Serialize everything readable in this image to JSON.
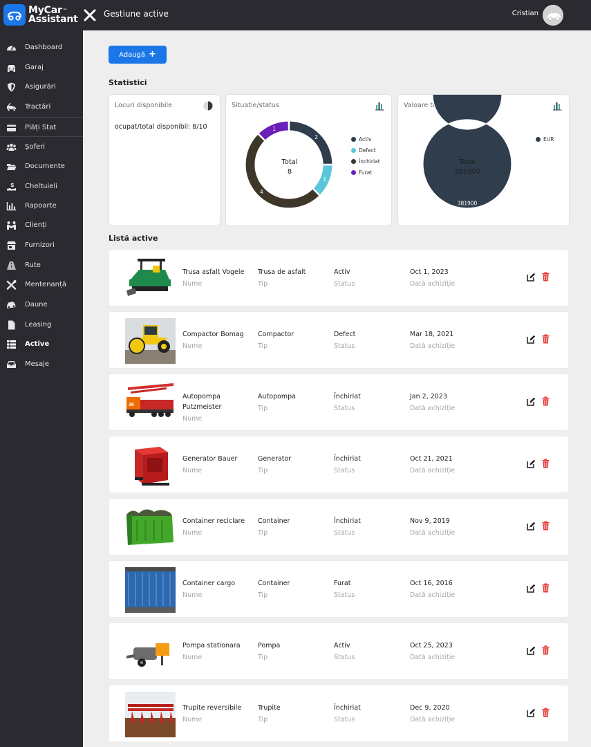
{
  "app": {
    "logo_line1": "MyCar",
    "logo_line2": "Assistant",
    "logo_tm": "™",
    "page_title": "Gestiune active",
    "user_name": "Cristian"
  },
  "sidebar": {
    "items": [
      {
        "label": "Dashboard",
        "icon": "gauge-icon"
      },
      {
        "label": "Garaj",
        "icon": "car-icon"
      },
      {
        "label": "Asigurări",
        "icon": "shield-icon"
      },
      {
        "label": "Tractări",
        "icon": "tow-truck-icon"
      },
      {
        "label": "Plăți Stat",
        "icon": "credit-card-icon"
      },
      {
        "label": "Șoferi",
        "icon": "users-icon"
      },
      {
        "label": "Documente",
        "icon": "folder-icon"
      },
      {
        "label": "Cheltuieli",
        "icon": "hand-money-icon"
      },
      {
        "label": "Rapoarte",
        "icon": "bar-chart-icon"
      },
      {
        "label": "Clienți",
        "icon": "handshake-icon"
      },
      {
        "label": "Furnizori",
        "icon": "store-icon"
      },
      {
        "label": "Rute",
        "icon": "road-icon"
      },
      {
        "label": "Mentenanță",
        "icon": "tools-icon"
      },
      {
        "label": "Daune",
        "icon": "car-crash-icon"
      },
      {
        "label": "Leasing",
        "icon": "document-icon"
      },
      {
        "label": "Active",
        "icon": "list-icon"
      },
      {
        "label": "Mesaje",
        "icon": "inbox-icon"
      }
    ],
    "active": "Active"
  },
  "main": {
    "add_button_label": "Adaugă",
    "add_button_plus": "+",
    "stats_title": "Statistici",
    "list_title": "Listă active",
    "card_occupancy": {
      "title": "Locuri disponibile",
      "text": "ocupat/total disponibil: 8/10",
      "icon": "pie-icon"
    },
    "card_status": {
      "title": "Situatie/status",
      "center_label": "Total",
      "center_value": "8",
      "icon": "bar-chart-icon"
    },
    "card_value": {
      "title": "Valoare totală",
      "center_label": "Total",
      "center_value": "381900",
      "icon": "bar-chart-icon"
    },
    "field_labels": {
      "name": "Nume",
      "type": "Tip",
      "status": "Status",
      "date": "Dată achiziție"
    },
    "assets": [
      {
        "name": "Trusa asfalt Vogele",
        "type": "Trusa de asfalt",
        "status": "Activ",
        "date": "Oct 1, 2023",
        "image": "asphalt-paver"
      },
      {
        "name": "Compactor Bomag",
        "type": "Compactor",
        "status": "Defect",
        "date": "Mar 18, 2021",
        "image": "road-roller"
      },
      {
        "name": "Autopompa Putzmeister",
        "type": "Autopompa",
        "status": "Închiriat",
        "date": "Jan 2, 2023",
        "image": "concrete-pump-truck"
      },
      {
        "name": "Generator Bauer",
        "type": "Generator",
        "status": "Închiriat",
        "date": "Oct 21, 2021",
        "image": "generator"
      },
      {
        "name": "Container reciclare",
        "type": "Container",
        "status": "Închiriat",
        "date": "Nov 9, 2019",
        "image": "green-container"
      },
      {
        "name": "Container cargo",
        "type": "Container",
        "status": "Furat",
        "date": "Oct 16, 2016",
        "image": "blue-container"
      },
      {
        "name": "Pompa stationara",
        "type": "Pompa",
        "status": "Activ",
        "date": "Oct 25, 2023",
        "image": "stationary-pump"
      },
      {
        "name": "Trupite reversibile",
        "type": "Trupite",
        "status": "Închiriat",
        "date": "Dec 9, 2020",
        "image": "reversible-plow"
      }
    ]
  },
  "chart_data": [
    {
      "type": "pie",
      "title": "Situatie/status",
      "categories": [
        "Activ",
        "Defect",
        "Închiriat",
        "Furat"
      ],
      "values": [
        2,
        1,
        4,
        1
      ],
      "colors": [
        "#2f3d4d",
        "#5bc6da",
        "#3e3628",
        "#6b1fb8"
      ],
      "legend": "right"
    },
    {
      "type": "pie",
      "title": "Valoare totală",
      "categories": [
        "EUR"
      ],
      "values": [
        381900
      ],
      "colors": [
        "#2f3d4d"
      ],
      "legend": "top-right"
    }
  ]
}
